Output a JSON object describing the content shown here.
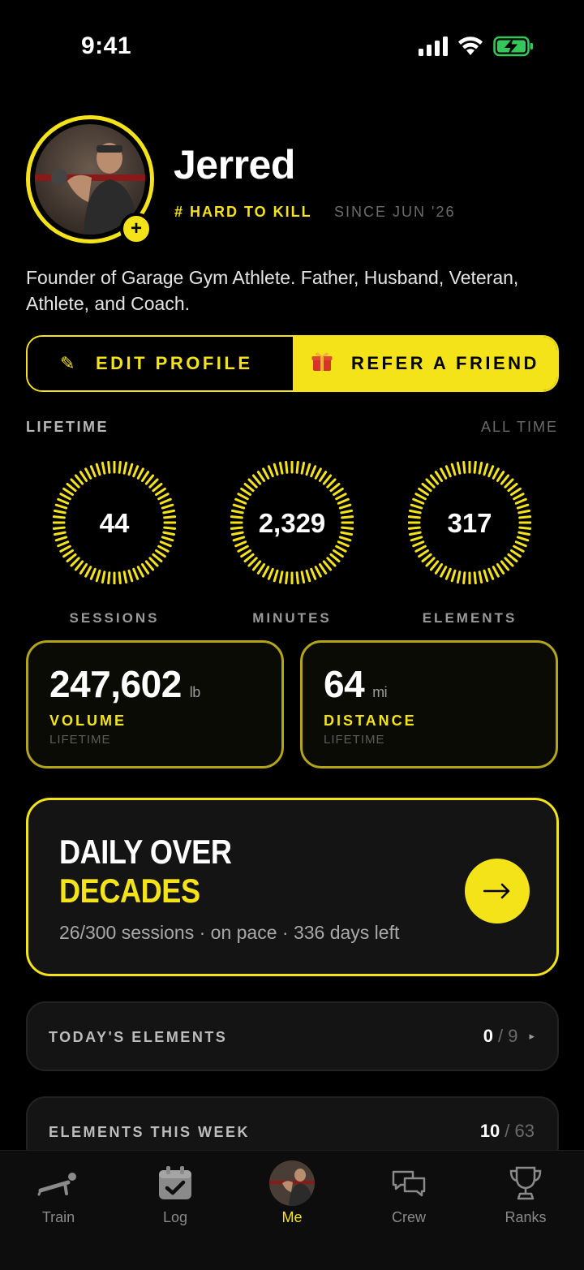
{
  "status": {
    "time": "9:41"
  },
  "profile": {
    "name": "Jerred",
    "tag": "# HARD TO KILL",
    "since": "SINCE JUN '26",
    "bio": "Founder of Garage Gym Athlete. Father, Husband, Veteran, Athlete, and Coach."
  },
  "actions": {
    "edit_label": "EDIT PROFILE",
    "refer_label": "REFER A FRIEND"
  },
  "lifetime": {
    "label": "LIFETIME",
    "range": "ALL TIME",
    "rings": [
      {
        "value": "44",
        "label": "SESSIONS"
      },
      {
        "value": "2,329",
        "label": "MINUTES"
      },
      {
        "value": "317",
        "label": "ELEMENTS"
      }
    ]
  },
  "stats": [
    {
      "value": "247,602",
      "unit": "lb",
      "name": "VOLUME",
      "sub": "LIFETIME"
    },
    {
      "value": "64",
      "unit": "mi",
      "name": "DISTANCE",
      "sub": "LIFETIME"
    }
  ],
  "goal": {
    "title_line1": "DAILY OVER",
    "title_line2": "DECADES",
    "subtitle": "26/300 sessions · on pace · 336 days left"
  },
  "elements_today": {
    "label": "TODAY'S ELEMENTS",
    "done": "0",
    "total": "/ 9"
  },
  "elements_week": {
    "label": "ELEMENTS THIS WEEK",
    "done": "10",
    "total": "/ 63"
  },
  "tabs": [
    {
      "label": "Train",
      "icon": "pushup-icon"
    },
    {
      "label": "Log",
      "icon": "calendar-check-icon"
    },
    {
      "label": "Me",
      "icon": "avatar"
    },
    {
      "label": "Crew",
      "icon": "chat-bubbles-icon"
    },
    {
      "label": "Ranks",
      "icon": "trophy-icon"
    }
  ],
  "colors": {
    "accent": "#f5e31a",
    "background": "#000000",
    "card": "#141414",
    "battery": "#35c759"
  }
}
